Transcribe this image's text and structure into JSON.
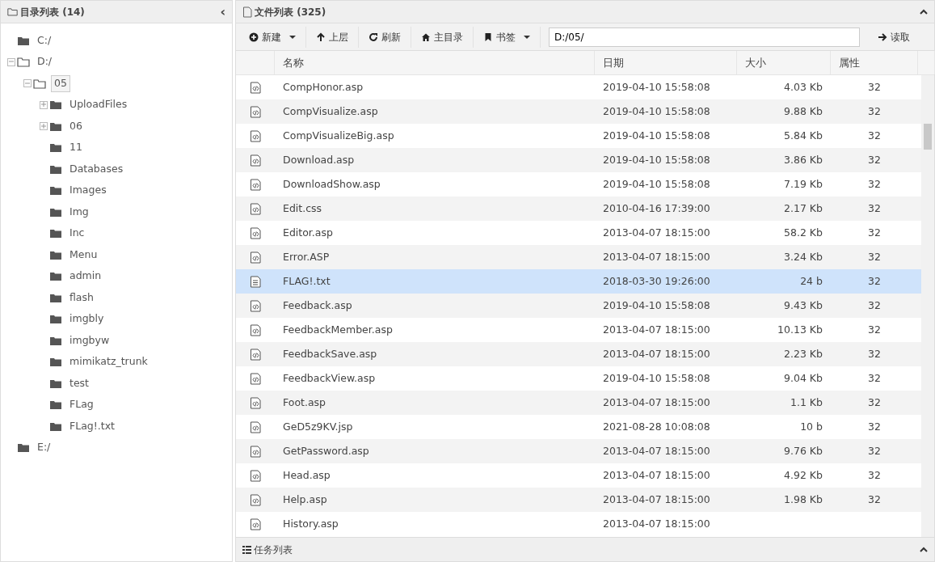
{
  "directory_panel": {
    "title": "目录列表 (14)",
    "collapse_glyph": "‹",
    "tree": [
      {
        "label": "C:/",
        "expandable": false,
        "expanded": false,
        "selected": false
      },
      {
        "label": "D:/",
        "expandable": true,
        "expanded": true,
        "selected": false,
        "children": [
          {
            "label": "05",
            "expandable": true,
            "expanded": true,
            "selected": true,
            "children": [
              {
                "label": "UploadFiles",
                "expandable": true,
                "expanded": false,
                "selected": false
              },
              {
                "label": "06",
                "expandable": true,
                "expanded": false,
                "selected": false
              },
              {
                "label": "11",
                "expandable": false,
                "expanded": false,
                "selected": false
              },
              {
                "label": "Databases",
                "expandable": false,
                "expanded": false,
                "selected": false
              },
              {
                "label": "Images",
                "expandable": false,
                "expanded": false,
                "selected": false
              },
              {
                "label": "Img",
                "expandable": false,
                "expanded": false,
                "selected": false
              },
              {
                "label": "Inc",
                "expandable": false,
                "expanded": false,
                "selected": false
              },
              {
                "label": "Menu",
                "expandable": false,
                "expanded": false,
                "selected": false
              },
              {
                "label": "admin",
                "expandable": false,
                "expanded": false,
                "selected": false
              },
              {
                "label": "flash",
                "expandable": false,
                "expanded": false,
                "selected": false
              },
              {
                "label": "imgbly",
                "expandable": false,
                "expanded": false,
                "selected": false
              },
              {
                "label": "imgbyw",
                "expandable": false,
                "expanded": false,
                "selected": false
              },
              {
                "label": "mimikatz_trunk",
                "expandable": false,
                "expanded": false,
                "selected": false
              },
              {
                "label": "test",
                "expandable": false,
                "expanded": false,
                "selected": false
              },
              {
                "label": "FLag",
                "expandable": false,
                "expanded": false,
                "selected": false
              },
              {
                "label": "FLag!.txt",
                "expandable": false,
                "expanded": false,
                "selected": false
              }
            ]
          }
        ]
      },
      {
        "label": "E:/",
        "expandable": false,
        "expanded": false,
        "selected": false
      }
    ]
  },
  "file_panel": {
    "title": "文件列表 (325)",
    "toolbar": [
      {
        "kind": "plus",
        "label": "新建",
        "dropdown": true
      },
      {
        "kind": "up",
        "label": "上层",
        "dropdown": false
      },
      {
        "kind": "refresh",
        "label": "刷新",
        "dropdown": false
      },
      {
        "kind": "home",
        "label": "主目录",
        "dropdown": false
      },
      {
        "kind": "bookmark",
        "label": "书签",
        "dropdown": true
      }
    ],
    "path_value": "D:/05/",
    "read_button": "读取",
    "columns": [
      "名称",
      "日期",
      "大小",
      "属性"
    ],
    "rows": [
      {
        "kind": "code",
        "name": "CompHonor.asp",
        "date": "2019-04-10 15:58:08",
        "size": "4.03 Kb",
        "attr": "32",
        "selected": false
      },
      {
        "kind": "code",
        "name": "CompVisualize.asp",
        "date": "2019-04-10 15:58:08",
        "size": "9.88 Kb",
        "attr": "32",
        "selected": false
      },
      {
        "kind": "code",
        "name": "CompVisualizeBig.asp",
        "date": "2019-04-10 15:58:08",
        "size": "5.84 Kb",
        "attr": "32",
        "selected": false
      },
      {
        "kind": "code",
        "name": "Download.asp",
        "date": "2019-04-10 15:58:08",
        "size": "3.86 Kb",
        "attr": "32",
        "selected": false
      },
      {
        "kind": "code",
        "name": "DownloadShow.asp",
        "date": "2019-04-10 15:58:08",
        "size": "7.19 Kb",
        "attr": "32",
        "selected": false
      },
      {
        "kind": "code",
        "name": "Edit.css",
        "date": "2010-04-16 17:39:00",
        "size": "2.17 Kb",
        "attr": "32",
        "selected": false
      },
      {
        "kind": "code",
        "name": "Editor.asp",
        "date": "2013-04-07 18:15:00",
        "size": "58.2 Kb",
        "attr": "32",
        "selected": false
      },
      {
        "kind": "code",
        "name": "Error.ASP",
        "date": "2013-04-07 18:15:00",
        "size": "3.24 Kb",
        "attr": "32",
        "selected": false
      },
      {
        "kind": "text",
        "name": "FLAG!.txt",
        "date": "2018-03-30 19:26:00",
        "size": "24 b",
        "attr": "32",
        "selected": true
      },
      {
        "kind": "code",
        "name": "Feedback.asp",
        "date": "2019-04-10 15:58:08",
        "size": "9.43 Kb",
        "attr": "32",
        "selected": false
      },
      {
        "kind": "code",
        "name": "FeedbackMember.asp",
        "date": "2013-04-07 18:15:00",
        "size": "10.13 Kb",
        "attr": "32",
        "selected": false
      },
      {
        "kind": "code",
        "name": "FeedbackSave.asp",
        "date": "2013-04-07 18:15:00",
        "size": "2.23 Kb",
        "attr": "32",
        "selected": false
      },
      {
        "kind": "code",
        "name": "FeedbackView.asp",
        "date": "2019-04-10 15:58:08",
        "size": "9.04 Kb",
        "attr": "32",
        "selected": false
      },
      {
        "kind": "code",
        "name": "Foot.asp",
        "date": "2013-04-07 18:15:00",
        "size": "1.1 Kb",
        "attr": "32",
        "selected": false
      },
      {
        "kind": "code",
        "name": "GeD5z9KV.jsp",
        "date": "2021-08-28 10:08:08",
        "size": "10 b",
        "attr": "32",
        "selected": false
      },
      {
        "kind": "code",
        "name": "GetPassword.asp",
        "date": "2013-04-07 18:15:00",
        "size": "9.76 Kb",
        "attr": "32",
        "selected": false
      },
      {
        "kind": "code",
        "name": "Head.asp",
        "date": "2013-04-07 18:15:00",
        "size": "4.92 Kb",
        "attr": "32",
        "selected": false
      },
      {
        "kind": "code",
        "name": "Help.asp",
        "date": "2013-04-07 18:15:00",
        "size": "1.98 Kb",
        "attr": "32",
        "selected": false
      },
      {
        "kind": "code",
        "name": "History.asp",
        "date": "2013-04-07 18:15:00",
        "selected": false
      }
    ]
  },
  "task_panel": {
    "title": "任务列表"
  }
}
